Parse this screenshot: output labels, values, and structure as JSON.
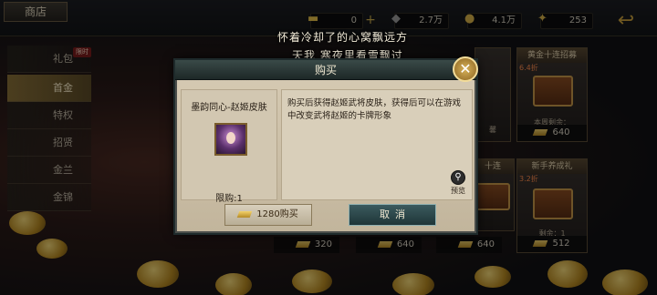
{
  "header": {
    "shop_title": "商店",
    "resources": [
      {
        "icon": "gold-ingot-icon",
        "value": "0"
      },
      {
        "icon": "copper-icon",
        "value": "2.7万"
      },
      {
        "icon": "coin-icon",
        "value": "4.1万"
      },
      {
        "icon": "gem-icon",
        "value": "253"
      }
    ],
    "plus_label": "+"
  },
  "sidebar": {
    "limited_tag": "限时",
    "items": [
      {
        "label": "礼包"
      },
      {
        "label": "首金"
      },
      {
        "label": "特权"
      },
      {
        "label": "招贤"
      },
      {
        "label": "金兰"
      },
      {
        "label": "金锦"
      }
    ],
    "active_index": 1
  },
  "lyrics": {
    "line1": "怀着冷却了的心窝飘远方",
    "line2": "天我 寒夜里看雪飘过"
  },
  "shop_cards": {
    "top_right": {
      "title": "黄金十连招募",
      "discount": "6.4折",
      "sub": "本周剩余：",
      "price": "640"
    },
    "mid_right": {
      "title": "新手养成礼",
      "discount": "3.2折",
      "sub": "剩余：1",
      "price": "512"
    },
    "mid_left_title": "十连",
    "partial_label": "馨",
    "bottom_prices": [
      "320",
      "640",
      "640"
    ]
  },
  "modal": {
    "title": "购买",
    "close_label": "✕",
    "item_name": "墨韵同心-赵姬皮肤",
    "limit_text": "限购:1",
    "description": "购买后获得赵姬武将皮肤，获得后可以在游戏中改变武将赵姬的卡牌形象",
    "preview_label": "预览",
    "buy_label": "1280购买",
    "cancel_label": "取消"
  }
}
